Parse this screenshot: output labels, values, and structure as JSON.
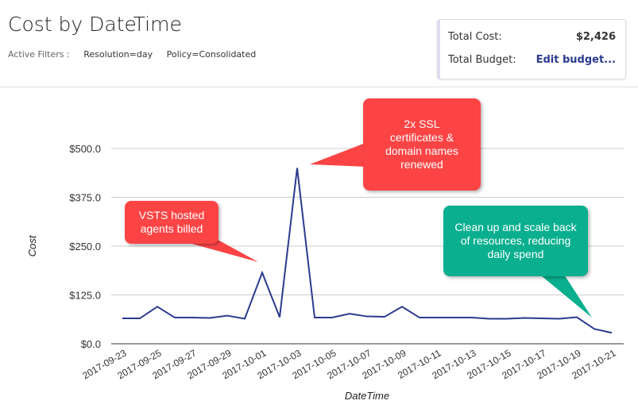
{
  "header": {
    "title": "Cost by DateTime",
    "filters_label": "Active Filters :",
    "filters": [
      "Resolution=day",
      "Policy=Consolidated"
    ]
  },
  "summary": {
    "total_cost_label": "Total Cost:",
    "total_cost": "$2,426",
    "total_budget_label": "Total Budget:",
    "edit_budget": "Edit budget..."
  },
  "chart_data": {
    "type": "line",
    "xlabel": "DateTime",
    "ylabel": "Cost",
    "ylim": [
      0,
      500
    ],
    "yticks": [
      "$0.0",
      "$125.0",
      "$250.0",
      "$375.0",
      "$500.0"
    ],
    "ytick_values": [
      0,
      125,
      250,
      375,
      500
    ],
    "x": [
      "2017-09-23",
      "2017-09-24",
      "2017-09-25",
      "2017-09-26",
      "2017-09-27",
      "2017-09-28",
      "2017-09-29",
      "2017-09-30",
      "2017-10-01",
      "2017-10-02",
      "2017-10-03",
      "2017-10-04",
      "2017-10-05",
      "2017-10-06",
      "2017-10-07",
      "2017-10-08",
      "2017-10-09",
      "2017-10-10",
      "2017-10-11",
      "2017-10-12",
      "2017-10-13",
      "2017-10-14",
      "2017-10-15",
      "2017-10-16",
      "2017-10-17",
      "2017-10-18",
      "2017-10-19",
      "2017-10-20",
      "2017-10-21"
    ],
    "values": [
      65,
      65,
      95,
      67,
      67,
      66,
      72,
      64,
      182,
      68,
      450,
      67,
      67,
      77,
      70,
      69,
      95,
      67,
      67,
      67,
      67,
      64,
      64,
      66,
      65,
      64,
      68,
      38,
      28
    ],
    "line_color": "#2b3a8f",
    "grid": true,
    "annotations": [
      {
        "text": "VSTS hosted agents billed",
        "color": "#fc4445",
        "target": "2017-10-01"
      },
      {
        "text": "2x SSL certificates & domain names renewed",
        "color": "#fc4445",
        "target": "2017-10-03"
      },
      {
        "text": "Clean up and scale back of resources, reducing daily spend",
        "color": "#0aaf8f",
        "target": "2017-10-20"
      }
    ]
  }
}
